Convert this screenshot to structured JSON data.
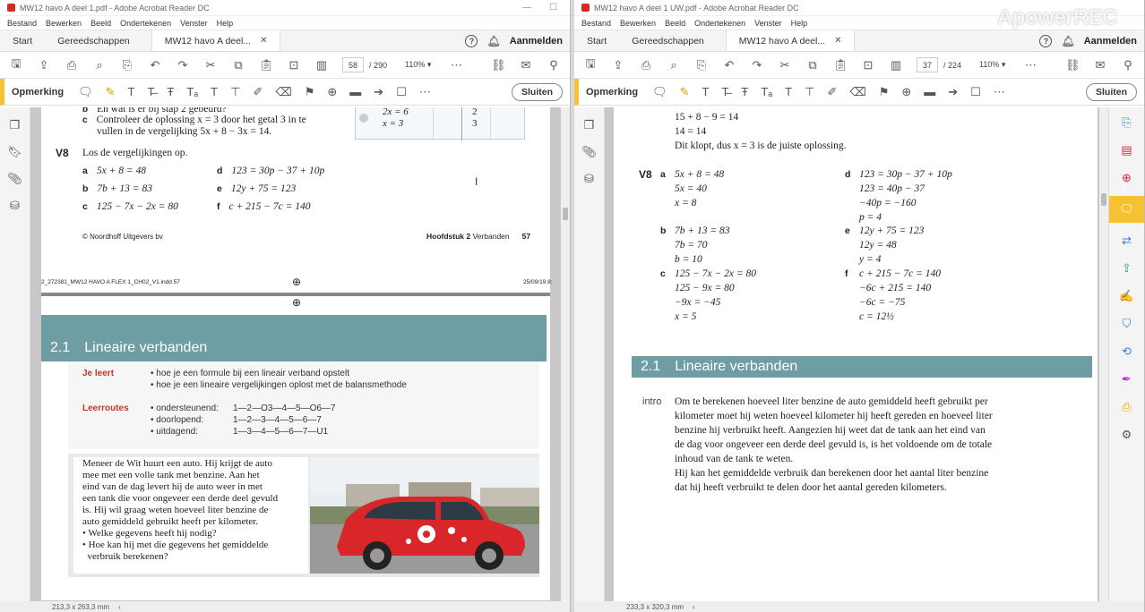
{
  "left": {
    "title": "MW12 havo A deel 1.pdf - Adobe Acrobat Reader DC",
    "menu": [
      "Bestand",
      "Bewerken",
      "Beeld",
      "Ondertekenen",
      "Venster",
      "Help"
    ],
    "tabs": {
      "start": "Start",
      "tools": "Gereedschappen",
      "doc": "MW12 havo A deel..."
    },
    "signin": "Aanmelden",
    "page_current": "58",
    "page_total": "/ 290",
    "zoom": "110%",
    "comment_label": "Opmerking",
    "close_label": "Sluiten",
    "status_size": "213,3 x 263,3 mm",
    "content": {
      "prev_c_label": "c",
      "prev_b_text": "En wat is er bij stap 2 gebeurd?",
      "prev_c_text1": "Controleer de oplossing x = 3 door het getal 3 in te",
      "prev_c_text2": "vullen in de vergelijking 5x + 8 − 3x = 14.",
      "table_r1_left": "2x = 6",
      "table_r1_right": "2",
      "table_r2_left": "x = 3",
      "table_r2_right": "3",
      "v8_label": "V8",
      "v8_intro": "Los de vergelijkingen op.",
      "items": [
        {
          "l": "a",
          "e": "5x + 8 = 48"
        },
        {
          "l": "b",
          "e": "7b + 13 = 83"
        },
        {
          "l": "c",
          "e": "125 − 7x − 2x = 80"
        },
        {
          "l": "d",
          "e": "123 = 30p − 37 + 10p"
        },
        {
          "l": "e",
          "e": "12y + 75 = 123"
        },
        {
          "l": "f",
          "e": "c + 215 − 7c = 140"
        }
      ],
      "footer_left": "© Noordhoff Uitgevers bv",
      "footer_chapter_bold": "Hoofdstuk 2",
      "footer_chapter": "Verbanden",
      "footer_page": "57",
      "slug_left": "2_272381_MW12 HAVO A FLEX 1_CH02_V1.indd   57",
      "slug_right": "25/09/19   8:",
      "section_num": "2.1",
      "section_title": "Lineaire verbanden",
      "je_leert": "Je leert",
      "leert_1": "• hoe je een formule bij een lineair verband opstelt",
      "leert_2": "• hoe je een lineaire vergelijkingen oplost met de balansmethode",
      "leerroutes": "Leerroutes",
      "routes": [
        {
          "n": "• ondersteunend:",
          "v": "1—2—O3—4—5—O6—7"
        },
        {
          "n": "• doorlopend:",
          "v": "1—2—3—4—5—6—7"
        },
        {
          "n": "• uitdagend:",
          "v": "1—3—4—5—6—7—U1"
        }
      ],
      "story": [
        "Meneer de Wit huurt een auto. Hij krijgt de auto",
        "mee met een volle tank met benzine. Aan het",
        "eind van de dag levert hij de auto weer in met",
        "een tank die voor ongeveer een derde deel gevuld",
        "is. Hij wil graag weten hoeveel liter benzine de",
        "auto gemiddeld gebruikt heeft per kilometer.",
        "• Welke gegevens heeft hij nodig?",
        "• Hoe kan hij met die gegevens het gemiddelde",
        "  verbruik berekenen?"
      ]
    }
  },
  "right": {
    "title": "MW12 havo A deel 1 UW.pdf - Adobe Acrobat Reader DC",
    "menu": [
      "Bestand",
      "Bewerken",
      "Beeld",
      "Ondertekenen",
      "Venster",
      "Help"
    ],
    "tabs": {
      "start": "Start",
      "tools": "Gereedschappen",
      "doc": "MW12 havo A deel..."
    },
    "signin": "Aanmelden",
    "page_current": "37",
    "page_total": "/ 224",
    "zoom": "110%",
    "comment_label": "Opmerking",
    "close_label": "Sluiten",
    "status_size": "233,3 x 320,3 mm",
    "content": {
      "top_lines": [
        "15 + 8 − 9 = 14",
        "14 = 14",
        "Dit klopt, dus x = 3 is de juiste oplossing."
      ],
      "v8_label": "V8",
      "col_left": [
        {
          "l": "a",
          "lines": [
            "5x + 8 = 48",
            "5x = 40",
            "x = 8"
          ]
        },
        {
          "l": "b",
          "lines": [
            "7b + 13 = 83",
            "7b = 70",
            "b = 10"
          ]
        },
        {
          "l": "c",
          "lines": [
            "125 − 7x − 2x = 80",
            "125 − 9x = 80",
            "−9x = −45",
            "x = 5"
          ]
        }
      ],
      "col_right": [
        {
          "l": "d",
          "lines": [
            "123 = 30p − 37 + 10p",
            "123 = 40p − 37",
            "−40p = −160",
            "p = 4"
          ]
        },
        {
          "l": "e",
          "lines": [
            "12y + 75 = 123",
            "12y = 48",
            "y = 4"
          ]
        },
        {
          "l": "f",
          "lines": [
            "c + 215 − 7c = 140",
            "−6c + 215 = 140",
            "−6c = −75",
            "c = 12½"
          ]
        }
      ],
      "section_num": "2.1",
      "section_title": "Lineaire verbanden",
      "intro_label": "intro",
      "intro_lines": [
        "Om te berekenen hoeveel liter benzine de auto gemiddeld heeft gebruikt per",
        "kilometer moet hij weten hoeveel kilometer hij heeft gereden en hoeveel liter",
        "benzine hij verbruikt heeft. Aangezien hij weet dat de tank aan het eind van",
        "de dag voor ongeveer een derde deel gevuld is, is het voldoende om de totale",
        "inhoud van de tank te weten.",
        "Hij kan het gemiddelde verbruik dan berekenen door het aantal liter benzine",
        "dat hij heeft verbruikt te delen door het aantal gereden kilometers."
      ]
    }
  },
  "watermark": "ApowerREC",
  "colors": {
    "section": "#6e9ea3",
    "accent_red": "#c0392b",
    "comment_yellow": "#f6c233"
  }
}
